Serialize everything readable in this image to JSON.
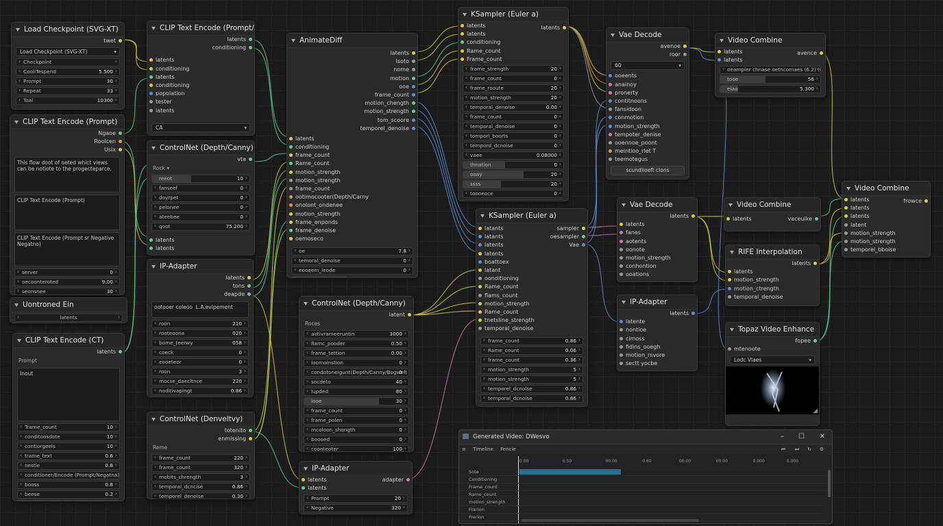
{
  "nodes": {
    "load_checkpoint": {
      "title": "Load Checkpoint (SVG-XT)",
      "out": [
        "twet"
      ],
      "dropdown": "Load Checkpoint (SVG-XT)",
      "widgets": [
        {
          "l": "Checkpoint",
          "v": ""
        },
        {
          "l": "CooliTespend",
          "v": "5.500"
        },
        {
          "l": "Prompt",
          "v": "30"
        },
        {
          "l": "Repeat",
          "v": "33"
        },
        {
          "l": "Toal",
          "v": "10300"
        }
      ]
    },
    "clip_prompt_negat": {
      "title": "CLIP Text Encode (Prompt/Negat",
      "out": [
        "latents",
        "conditioning"
      ],
      "in": [
        "latents",
        "conditioning",
        "latents",
        "conditioning",
        "popolation",
        "tester",
        "latents"
      ],
      "field": "CA"
    },
    "animatediff": {
      "title": "AnimateDiff",
      "out": [
        "latents",
        "lsoto",
        "nome",
        "motion",
        "ooe",
        "frame_count",
        "motion_chength",
        "motion_strength",
        "tom_scoore",
        "temporel_denoise"
      ],
      "in": [
        "latents",
        "conditioning",
        "frame_count",
        "Rame_count",
        "motion_strength",
        "motion_strength",
        "frame_count",
        "ootimocooter(Depth/Carny",
        "onolont_ondenee",
        "motion_strength",
        "frame_enponds",
        "frame_denoise",
        "oemoseco"
      ],
      "widgets": [
        {
          "l": "oe",
          "v": "7.8"
        },
        {
          "l": "temoral_denoise",
          "v": "0"
        },
        {
          "l": "eooeem_leode",
          "v": "0"
        },
        {
          "l": "eooeeeeee",
          "v": "7620"
        }
      ]
    },
    "ksampler1": {
      "title": "KSampler (Euler a)",
      "out": [
        "latents"
      ],
      "in": [
        "latents",
        "latents",
        "conditioning",
        "Rame_count",
        "Frame_count"
      ],
      "widgets": [
        {
          "l": "frame_strength",
          "v": "20"
        },
        {
          "l": "frame_count",
          "v": "0"
        },
        {
          "l": "frame_rooute",
          "v": "20"
        },
        {
          "l": "motion_strength",
          "v": "20"
        },
        {
          "l": "temporal_denoise",
          "v": "0.00"
        },
        {
          "l": "frame_count",
          "v": "0"
        },
        {
          "l": "temporal_denoise",
          "v": "0"
        },
        {
          "l": "tomporl_boorts",
          "v": "0"
        },
        {
          "l": "tempord_dcnoise",
          "v": "0"
        },
        {
          "l": "vaee",
          "v": "0.08000"
        },
        {
          "l": "thnation",
          "v": "0"
        },
        {
          "l": "ooay",
          "v": "20"
        },
        {
          "l": "ssss",
          "v": "20"
        },
        {
          "l": "toooeoce",
          "v": "0"
        },
        {
          "l": "tenpord_teanis",
          "v": "20"
        },
        {
          "l": "temporal_denoise",
          "v": "0"
        }
      ]
    },
    "vae_decode1": {
      "title": "Vae Decode",
      "out": [
        "avenoe",
        "roor"
      ],
      "dropdown": "60",
      "in": [
        "ooeents",
        "anainoy",
        "pronerty",
        "contitnoons",
        "fansidoon",
        "conmotion",
        "motion_strength",
        "tempoter_denise",
        "ooennoe_poont",
        "meintioo_rlet T",
        "teemotegus"
      ],
      "button": "scundlioeft clons"
    },
    "video_combine1": {
      "title": "Video Combine",
      "out": [
        "avence"
      ],
      "in": [
        "latents",
        "latents"
      ],
      "widgets": [
        {
          "l": "oeampier chnase oetncomaes (6.2) (0",
          "v": ""
        },
        {
          "l": "tooe",
          "v": "56"
        },
        {
          "l": "eiaa",
          "v": "5.300"
        }
      ]
    },
    "clip_prompt": {
      "title": "CLIP Text Encode (Prompt)",
      "out": [
        "Ngaoe",
        "Roolcen",
        "Usix"
      ],
      "text1": "This flow doot of oeted whict views can be notiote to the progecteparce.",
      "text2": "CLIP Text Encode (Prompt)",
      "text3": "CLIP Text Encode (Prompt sr Negative Negatno)",
      "widgets": [
        {
          "l": "server",
          "v": "0"
        },
        {
          "l": "oecoonteroted",
          "v": "9.00"
        },
        {
          "l": "seonsnee",
          "v": "30"
        }
      ]
    },
    "unconed": {
      "title": "Uontroned Ein",
      "widget": "latents"
    },
    "clip_ct": {
      "title": "CLIP Text Encode (CT)",
      "out": [
        "latents"
      ],
      "sub": "Prompt",
      "text": "Inout",
      "widgets": [
        {
          "l": "Trame_count",
          "v": "10"
        },
        {
          "l": "conditoosdote",
          "v": "10"
        },
        {
          "l": "contiorgeels",
          "v": "10"
        },
        {
          "l": "trame_text",
          "v": "0.6"
        },
        {
          "l": "nestle",
          "v": "0.8"
        },
        {
          "l": "conditioner/Encode (Prompt/Negatna)",
          "v": ""
        },
        {
          "l": "booss",
          "v": "0.8"
        },
        {
          "l": "beese",
          "v": "0.2"
        },
        {
          "l": "somb",
          "v": "0"
        }
      ]
    },
    "controlnet1": {
      "title": "ControlNet (Depth/Canny)",
      "out": [
        "vta"
      ],
      "sub": "Rock",
      "widgets": [
        {
          "l": "reeot",
          "v": "10"
        },
        {
          "l": "fanseef",
          "v": "0"
        },
        {
          "l": "doyrpet",
          "v": "0"
        },
        {
          "l": "pelonee",
          "v": "0"
        },
        {
          "l": "ateebee",
          "v": "0"
        },
        {
          "l": "qoot",
          "v": "75.200"
        }
      ],
      "in": [
        "latents",
        "latents"
      ]
    },
    "ip_adapter1": {
      "title": "IP-Adapter",
      "out": [
        "latents",
        "tons",
        "deapde"
      ],
      "widgets": [
        {
          "l": "ootooer coleoo",
          "v": "L.A.evipement"
        },
        {
          "l": "roon",
          "v": "210"
        },
        {
          "l": "rooteoona",
          "v": "020"
        },
        {
          "l": "bome_teerwy",
          "v": "058"
        },
        {
          "l": "coeck",
          "v": "0"
        },
        {
          "l": "eooeteor",
          "v": "0"
        },
        {
          "l": "roon",
          "v": "3"
        },
        {
          "l": "mocse_daecltnce",
          "v": "220"
        },
        {
          "l": "noditivapingt",
          "v": "0.86"
        }
      ]
    },
    "controlnet_denvelty": {
      "title": "ControlNet (Denveltvy)",
      "out": [
        "totenito",
        "enmissing"
      ],
      "sub": "Reme",
      "widgets": [
        {
          "l": "frame_count",
          "v": "220"
        },
        {
          "l": "frame_count",
          "v": "320"
        },
        {
          "l": "mobits_chrength",
          "v": "3"
        },
        {
          "l": "temporal_dcncise",
          "v": "0.86"
        },
        {
          "l": "temporel_denoise",
          "v": "0.30"
        }
      ]
    },
    "controlnet2": {
      "title": "ControlNet (Depth/Canny)",
      "out": [
        "latent"
      ],
      "sub": "Roces",
      "widgets": [
        {
          "l": "aotivrameeruntin",
          "v": "3000"
        },
        {
          "l": "fiamc_pooder",
          "v": "0.50"
        },
        {
          "l": "frame_tettion",
          "v": "0.00"
        },
        {
          "l": "loomoinstion",
          "v": "0"
        },
        {
          "l": "condotoneigunt(Depth/Canny/Bogwel)",
          "v": "0"
        },
        {
          "l": "socdeto",
          "v": "40"
        },
        {
          "l": "lupded",
          "v": "80"
        },
        {
          "l": "iooe",
          "v": "30"
        },
        {
          "l": "frame_count",
          "v": "0"
        },
        {
          "l": "frame_polen",
          "v": "0"
        },
        {
          "l": "mcoloon_shongth",
          "v": "0"
        },
        {
          "l": "boooed",
          "v": "0"
        },
        {
          "l": "coonteoter",
          "v": "100"
        },
        {
          "l": "adapter",
          "v": "320"
        }
      ]
    },
    "ip_adapter2": {
      "title": "IP-Adapter",
      "out": [
        "adapter"
      ],
      "in": [
        "latents",
        "latents"
      ],
      "widgets": [
        {
          "l": "Prompt",
          "v": "20"
        },
        {
          "l": "Negative",
          "v": "320"
        }
      ]
    },
    "ksampler2": {
      "title": "KSampler (Euler a)",
      "out": [
        "sampler",
        "oesampler",
        "Vae"
      ],
      "in": [
        "latants",
        "latants",
        "latents",
        "latents",
        "boattoex",
        "latant",
        "oonditioning",
        "Rame_count",
        "flams_count",
        "motion_strength",
        "Rame_count",
        "tnetsline_strength",
        "temporal_denoise"
      ],
      "widgets": [
        {
          "l": "frame_count",
          "v": "0.86"
        },
        {
          "l": "Rame_count",
          "v": "0.06"
        },
        {
          "l": "frame_count",
          "v": "0.36"
        },
        {
          "l": "motion_strength",
          "v": "5"
        },
        {
          "l": "motion_strength",
          "v": "5"
        },
        {
          "l": "temporel_dcnolse",
          "v": "0.86"
        },
        {
          "l": "temporal_dcnoise",
          "v": "0.86"
        }
      ]
    },
    "vae_decode2": {
      "title": "Vae Decode",
      "out": [
        "latents"
      ],
      "in": [
        "latents",
        "fanes",
        "aotents",
        "oonote",
        "motion_strength",
        "conhontion",
        "ooations"
      ]
    },
    "ip_adapter3": {
      "title": "IP-Adapter",
      "out": [
        "latents"
      ],
      "in": [
        "latente",
        "nontioe",
        "cimoss",
        "fidins_ooegh",
        "motion_rsvore",
        "sectt yocbe"
      ]
    },
    "video_combine2": {
      "title": "Video Combine",
      "out": [
        "vaceuike"
      ],
      "in": [
        "latents"
      ]
    },
    "rife": {
      "title": "RIFE Interpolation",
      "out": [
        "latents"
      ],
      "in": [
        "latents",
        "motion_strength",
        "motion_ctrength",
        "temporal_denoise"
      ]
    },
    "topaz": {
      "title": "Topaz Video Enhance",
      "out": [
        "fopee"
      ],
      "in": [
        "mtenoote"
      ],
      "dropdown": "Lodc Vlaes"
    },
    "video_combine3": {
      "title": "Video Combine",
      "out": [
        "frowce"
      ],
      "in": [
        "latents",
        "latents",
        "latents",
        "latent",
        "motion_strength",
        "motion_strength",
        "temporel_bboise"
      ]
    }
  },
  "player": {
    "title": "Generated Video: DWesvo",
    "tabs": [
      "Timeline",
      "Fencie"
    ],
    "ruler": [
      "0.00",
      "0.50",
      "00:00",
      "0.60",
      "06:00",
      "00:00",
      "0.000",
      "0.000",
      "0.000"
    ],
    "tracks": [
      "Sote",
      "Conditioning",
      "Frame_count",
      "Rame_count",
      "motion_strength",
      "Fterion",
      "Frerion"
    ]
  },
  "colors": {
    "yellow": "#d9cf4a",
    "green": "#5fd08a",
    "blue": "#5b8fd6",
    "pink": "#d07ab3",
    "orange": "#d79a57",
    "purple": "#a07ad6",
    "gray": "#9a9a9a"
  }
}
